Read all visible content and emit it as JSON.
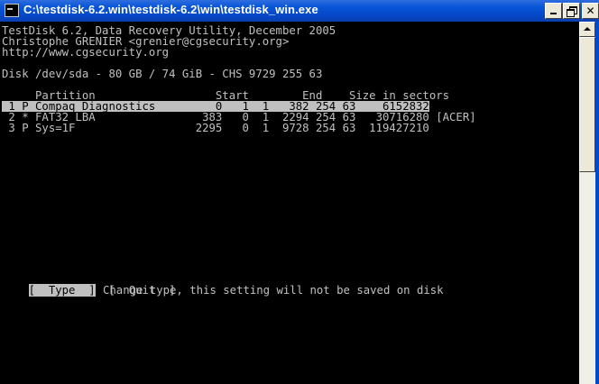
{
  "window": {
    "title": "C:\\testdisk-6.2.win\\testdisk-6.2\\win\\testdisk_win.exe"
  },
  "header": {
    "line1": "TestDisk 6.2, Data Recovery Utility, December 2005",
    "line2": "Christophe GRENIER <grenier@cgsecurity.org>",
    "line3": "http://www.cgsecurity.org"
  },
  "disk": {
    "info": "Disk /dev/sda - 80 GB / 74 GiB - CHS 9729 255 63"
  },
  "table": {
    "header": "     Partition                  Start        End    Size in sectors",
    "rows": [
      " 1 P Compaq Diagnostics         0   1  1   382 254 63    6152832",
      " 2 * FAT32 LBA                383   0  1  2294 254 63   30716280 [ACER]",
      " 3 P Sys=1F                  2295   0  1  9728 254 63  119427210"
    ],
    "selected_index": 0
  },
  "menu": {
    "type_label": "[  Type  ]",
    "quit_label": "[  Quit  ]",
    "hint": "Change type, this setting will not be saved on disk"
  }
}
